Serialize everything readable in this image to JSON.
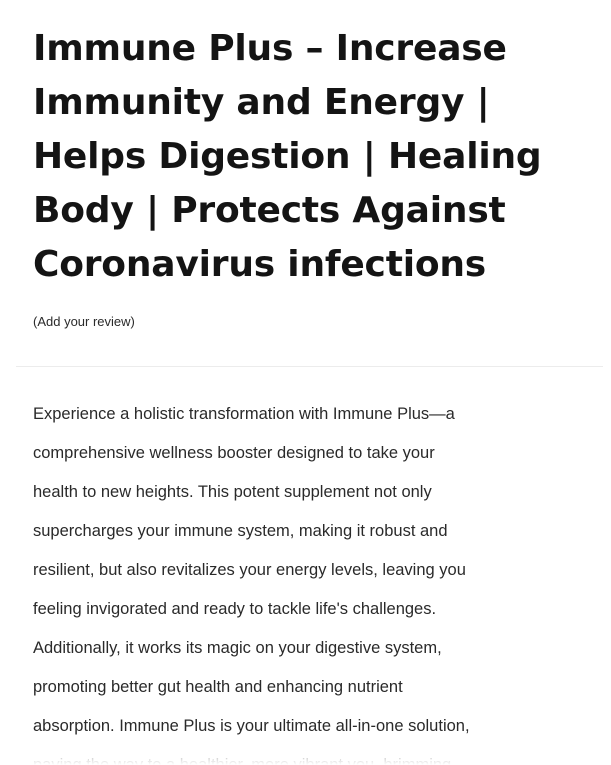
{
  "product": {
    "title": "Immune Plus – Increase Immunity and Energy | Helps Digestion | Healing Body | Protects Against Coronavirus infections",
    "review_link_label": "(Add your review)"
  },
  "description": {
    "lines": [
      "Experience a holistic transformation with Immune Plus—a",
      "comprehensive wellness booster designed to take your",
      "health to new heights. This potent supplement not only",
      "supercharges your immune system, making it robust and",
      "resilient, but also revitalizes your energy levels, leaving you",
      "feeling invigorated and ready to tackle life's challenges.",
      "Additionally, it works its magic on your digestive system,",
      "promoting better gut health and enhancing nutrient",
      "absorption. Immune Plus is your ultimate all-in-one solution,",
      "paving the way to a healthier, more vibrant you, brimming"
    ]
  }
}
